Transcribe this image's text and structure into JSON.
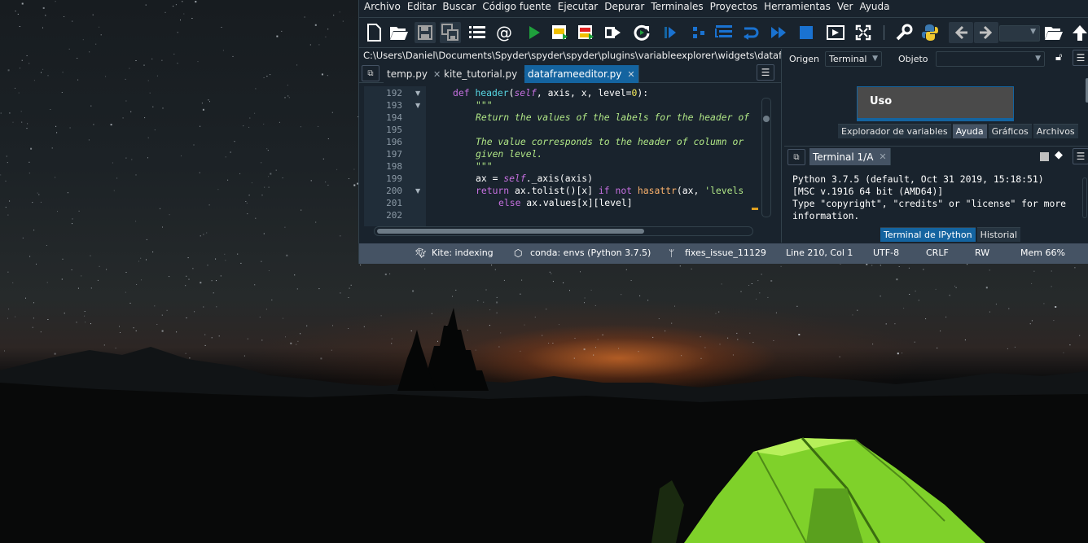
{
  "menubar": {
    "items": [
      "Archivo",
      "Editar",
      "Buscar",
      "Código fuente",
      "Ejecutar",
      "Depurar",
      "Terminales",
      "Proyectos",
      "Herramientas",
      "Ver",
      "Ayuda"
    ]
  },
  "toolbar": {
    "icons": [
      "new-file-icon",
      "open-file-icon",
      "save-icon",
      "save-all-icon",
      "outline-icon",
      "at-icon",
      "run-icon",
      "run-cell-icon",
      "run-cell-advance-icon",
      "run-selection-icon",
      "rerun-icon",
      "debug-icon",
      "debug-step-icon",
      "debug-step-into-icon",
      "debug-step-return-icon",
      "debug-continue-icon",
      "stop-icon",
      "maximize-pane-icon",
      "fullscreen-icon",
      "tools-icon",
      "python-path-icon",
      "back-icon",
      "forward-icon",
      "browse-dir-icon",
      "parent-dir-icon"
    ]
  },
  "editor": {
    "path": "C:\\Users\\Daniel\\Documents\\Spyder\\spyder\\spyder\\plugins\\variableexplorer\\widgets\\dataframeeditor.py",
    "tabs": [
      {
        "label": "temp.py",
        "active": false
      },
      {
        "label": "kite_tutorial.py",
        "active": false
      },
      {
        "label": "dataframeeditor.py",
        "active": true
      }
    ],
    "line_numbers": [
      "192",
      "193",
      "194",
      "195",
      "196",
      "197",
      "198",
      "199",
      "200",
      "201",
      "202"
    ],
    "code": {
      "l192_kw": "def",
      "l192_fn": "header",
      "l192_self": "self",
      "l192_rest": ", axis, x, level=",
      "l192_num": "0",
      "l192_end": "):",
      "l193": "\"\"\"",
      "l194": "Return the values of the labels for the header of",
      "l196": "The value corresponds to the header of column or",
      "l197": "given level.",
      "l198": "\"\"\"",
      "l199_a": "ax = ",
      "l199_self": "self",
      "l199_b": "._axis(axis)",
      "l200_kw": "return",
      "l200_a": " ax.tolist()[x] ",
      "l200_if": "if",
      "l200_not": "not",
      "l200_hasattr": "hasattr",
      "l200_b": "(ax, ",
      "l200_str": "'levels",
      "l201_else": "else",
      "l201_rest": " ax.values[x][level]"
    }
  },
  "help": {
    "source_label": "Origen",
    "source_value": "Terminal",
    "object_label": "Objeto",
    "object_value": "",
    "content_title": "Uso",
    "tabs": [
      {
        "label": "Explorador de variables",
        "active": false
      },
      {
        "label": "Ayuda",
        "active": true
      },
      {
        "label": "Gráficos",
        "active": false
      },
      {
        "label": "Archivos",
        "active": false
      }
    ]
  },
  "console": {
    "tab_label": "Terminal 1/A",
    "output": [
      "Python 3.7.5 (default, Oct 31 2019, 15:18:51)",
      "[MSC v.1916 64 bit (AMD64)]",
      "Type \"copyright\", \"credits\" or \"license\" for more",
      "information."
    ],
    "tabs": [
      {
        "label": "Terminal de IPython",
        "active": true
      },
      {
        "label": "Historial",
        "active": false
      }
    ]
  },
  "statusbar": {
    "kite": "Kite: indexing",
    "conda": "conda: envs (Python 3.7.5)",
    "git": "fixes_issue_11129",
    "position": "Line 210, Col 1",
    "encoding": "UTF-8",
    "eol": "CRLF",
    "permissions": "RW",
    "memory": "Mem 66%"
  },
  "colors": {
    "window_bg": "#19232d",
    "accent": "#1464a0",
    "statusbar_bg": "#455364"
  }
}
